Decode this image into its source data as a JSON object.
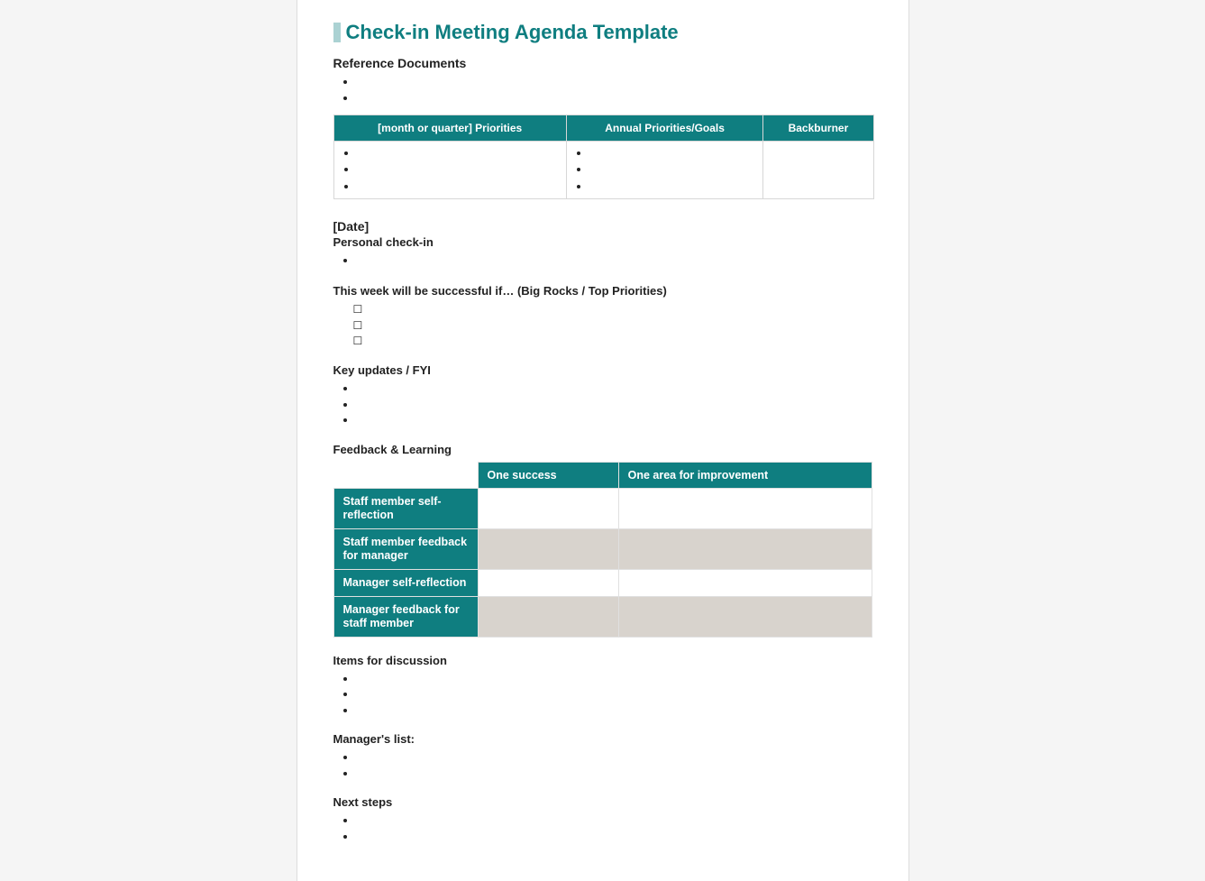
{
  "title": "Check-in Meeting Agenda Template",
  "sections": {
    "reference_docs": "Reference Documents",
    "date": "[Date]",
    "personal_checkin": "Personal check-in",
    "successful_if": "This week will be successful if… (Big Rocks / Top Priorities)",
    "key_updates": "Key updates / FYI",
    "feedback_learning": "Feedback & Learning",
    "items_discussion": "Items for discussion",
    "managers_list": "Manager's list:",
    "next_steps": "Next steps"
  },
  "priorities_table": {
    "headers": [
      "[month or quarter] Priorities",
      "Annual Priorities/Goals",
      "Backburner"
    ],
    "col1_bullets": [
      "",
      "",
      ""
    ],
    "col2_bullets": [
      "",
      "",
      ""
    ]
  },
  "feedback_table": {
    "col_headers": [
      "One success",
      "One area for improvement"
    ],
    "row_headers": [
      "Staff member self-reflection",
      "Staff member feedback for manager",
      "Manager self-reflection",
      "Manager feedback for staff member"
    ]
  }
}
